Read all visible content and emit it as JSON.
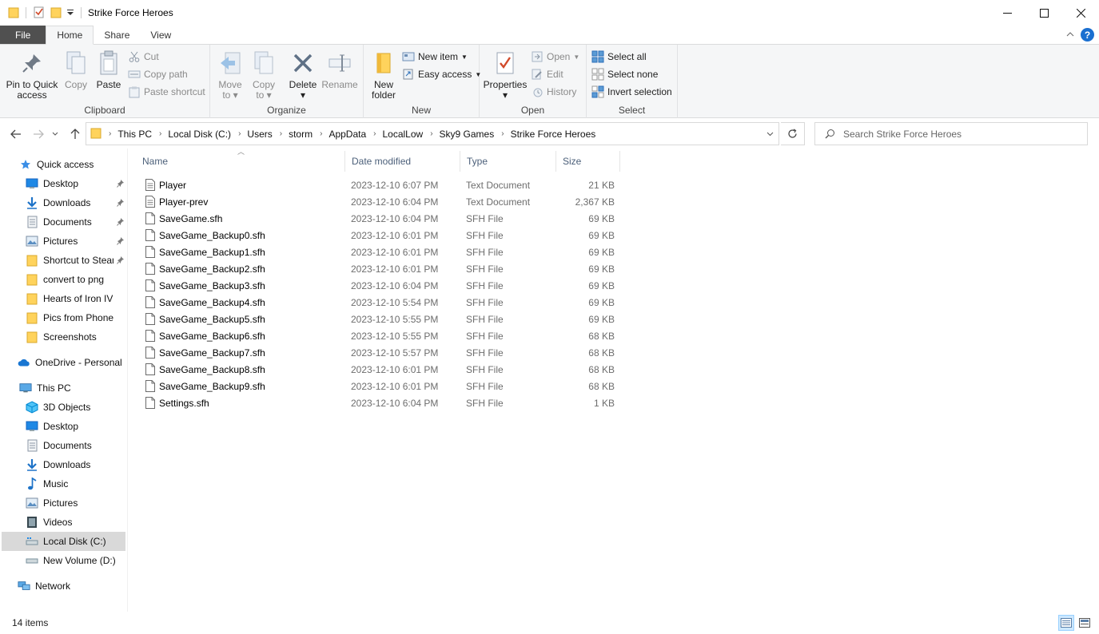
{
  "window": {
    "title": "Strike Force Heroes"
  },
  "tabs": {
    "file": "File",
    "home": "Home",
    "share": "Share",
    "view": "View"
  },
  "ribbon": {
    "clipboard": {
      "label": "Clipboard",
      "pin": [
        "Pin to Quick",
        "access"
      ],
      "copy": "Copy",
      "paste": "Paste",
      "cut": "Cut",
      "copy_path": "Copy path",
      "paste_shortcut": "Paste shortcut"
    },
    "organize": {
      "label": "Organize",
      "move_to": [
        "Move",
        "to"
      ],
      "copy_to": [
        "Copy",
        "to"
      ],
      "delete": "Delete",
      "rename": "Rename"
    },
    "new": {
      "label": "New",
      "new_folder": [
        "New",
        "folder"
      ],
      "new_item": "New item",
      "easy_access": "Easy access"
    },
    "open": {
      "label": "Open",
      "properties": "Properties",
      "open": "Open",
      "edit": "Edit",
      "history": "History"
    },
    "select": {
      "label": "Select",
      "select_all": "Select all",
      "select_none": "Select none",
      "invert_selection": "Invert selection"
    }
  },
  "address": {
    "crumbs": [
      "This PC",
      "Local Disk (C:)",
      "Users",
      "storm",
      "AppData",
      "LocalLow",
      "Sky9 Games",
      "Strike Force Heroes"
    ]
  },
  "search": {
    "placeholder": "Search Strike Force Heroes"
  },
  "nav": {
    "quick_access": "Quick access",
    "quick_items": [
      "Desktop",
      "Downloads",
      "Documents",
      "Pictures",
      "Shortcut to Steam",
      "convert to png",
      "Hearts of Iron IV",
      "Pics from Phone",
      "Screenshots"
    ],
    "onedrive": "OneDrive - Personal",
    "this_pc": "This PC",
    "pc_items": [
      "3D Objects",
      "Desktop",
      "Documents",
      "Downloads",
      "Music",
      "Pictures",
      "Videos",
      "Local Disk (C:)",
      "New Volume (D:)"
    ],
    "network": "Network"
  },
  "columns": {
    "name": "Name",
    "date": "Date modified",
    "type": "Type",
    "size": "Size"
  },
  "files": [
    {
      "name": "Player",
      "date": "2023-12-10 6:07 PM",
      "type": "Text Document",
      "size": "21 KB",
      "icon": "text-file-icon"
    },
    {
      "name": "Player-prev",
      "date": "2023-12-10 6:04 PM",
      "type": "Text Document",
      "size": "2,367 KB",
      "icon": "text-file-icon"
    },
    {
      "name": "SaveGame.sfh",
      "date": "2023-12-10 6:04 PM",
      "type": "SFH File",
      "size": "69 KB",
      "icon": "file-icon"
    },
    {
      "name": "SaveGame_Backup0.sfh",
      "date": "2023-12-10 6:01 PM",
      "type": "SFH File",
      "size": "69 KB",
      "icon": "file-icon"
    },
    {
      "name": "SaveGame_Backup1.sfh",
      "date": "2023-12-10 6:01 PM",
      "type": "SFH File",
      "size": "69 KB",
      "icon": "file-icon"
    },
    {
      "name": "SaveGame_Backup2.sfh",
      "date": "2023-12-10 6:01 PM",
      "type": "SFH File",
      "size": "69 KB",
      "icon": "file-icon"
    },
    {
      "name": "SaveGame_Backup3.sfh",
      "date": "2023-12-10 6:04 PM",
      "type": "SFH File",
      "size": "69 KB",
      "icon": "file-icon"
    },
    {
      "name": "SaveGame_Backup4.sfh",
      "date": "2023-12-10 5:54 PM",
      "type": "SFH File",
      "size": "69 KB",
      "icon": "file-icon"
    },
    {
      "name": "SaveGame_Backup5.sfh",
      "date": "2023-12-10 5:55 PM",
      "type": "SFH File",
      "size": "69 KB",
      "icon": "file-icon"
    },
    {
      "name": "SaveGame_Backup6.sfh",
      "date": "2023-12-10 5:55 PM",
      "type": "SFH File",
      "size": "68 KB",
      "icon": "file-icon"
    },
    {
      "name": "SaveGame_Backup7.sfh",
      "date": "2023-12-10 5:57 PM",
      "type": "SFH File",
      "size": "68 KB",
      "icon": "file-icon"
    },
    {
      "name": "SaveGame_Backup8.sfh",
      "date": "2023-12-10 6:01 PM",
      "type": "SFH File",
      "size": "68 KB",
      "icon": "file-icon"
    },
    {
      "name": "SaveGame_Backup9.sfh",
      "date": "2023-12-10 6:01 PM",
      "type": "SFH File",
      "size": "68 KB",
      "icon": "file-icon"
    },
    {
      "name": "Settings.sfh",
      "date": "2023-12-10 6:04 PM",
      "type": "SFH File",
      "size": "1 KB",
      "icon": "file-icon"
    }
  ],
  "status": {
    "count": "14 items"
  },
  "colors": {
    "folder": "#ffd35c",
    "accent": "#1a6fd0",
    "file_tab": "#505050"
  }
}
